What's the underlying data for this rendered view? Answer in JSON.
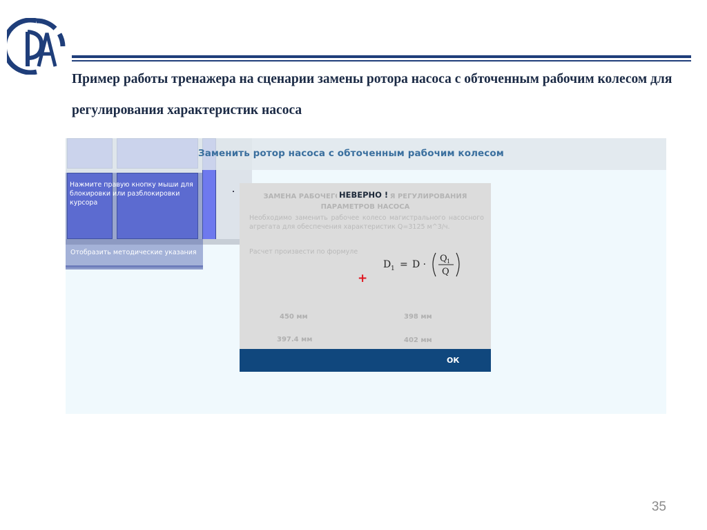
{
  "slide": {
    "title": "Пример работы тренажера на сценарии замены ротора насоса с обточенным рабочим колесом для регулирования характеристик насоса",
    "page_number": "35",
    "accent_color": "#1f3e7a"
  },
  "simulator": {
    "header_title": "Заменить ротор насоса с обточенным рабочим колесом",
    "hint_panel": {
      "text": "Нажмите правую кнопку мыши для блокировки или разблокировки курсора",
      "link": "Отобразить методические указания"
    },
    "dialog": {
      "alert": "НЕВЕРНО !",
      "ghost_title": "ЗАМЕНА РАБОЧЕГО КОЛЕСА ДЛЯ РЕГУЛИРОВАНИЯ ПАРАМЕТРОВ НАСОСА",
      "ghost_text": "Необходимо заменить рабочее колесо магистрального насосного агрегата для обеспечения характеристик Q=3125 м^3/ч.",
      "ghost_hint": "Расчет произвести по формуле",
      "formula": {
        "lhs": "D",
        "lhs_sub": "1",
        "eq": "=",
        "rhs": "D ·",
        "numerator": "Q",
        "numerator_sub": "1",
        "denominator": "Q"
      },
      "plus_symbol": "+",
      "answers": [
        "450 мм",
        "398 мм",
        "397.4 мм",
        "402 мм"
      ],
      "ok_label": "ОК",
      "ok_color": "#10477d",
      "alert_color": "#e0141e"
    }
  }
}
